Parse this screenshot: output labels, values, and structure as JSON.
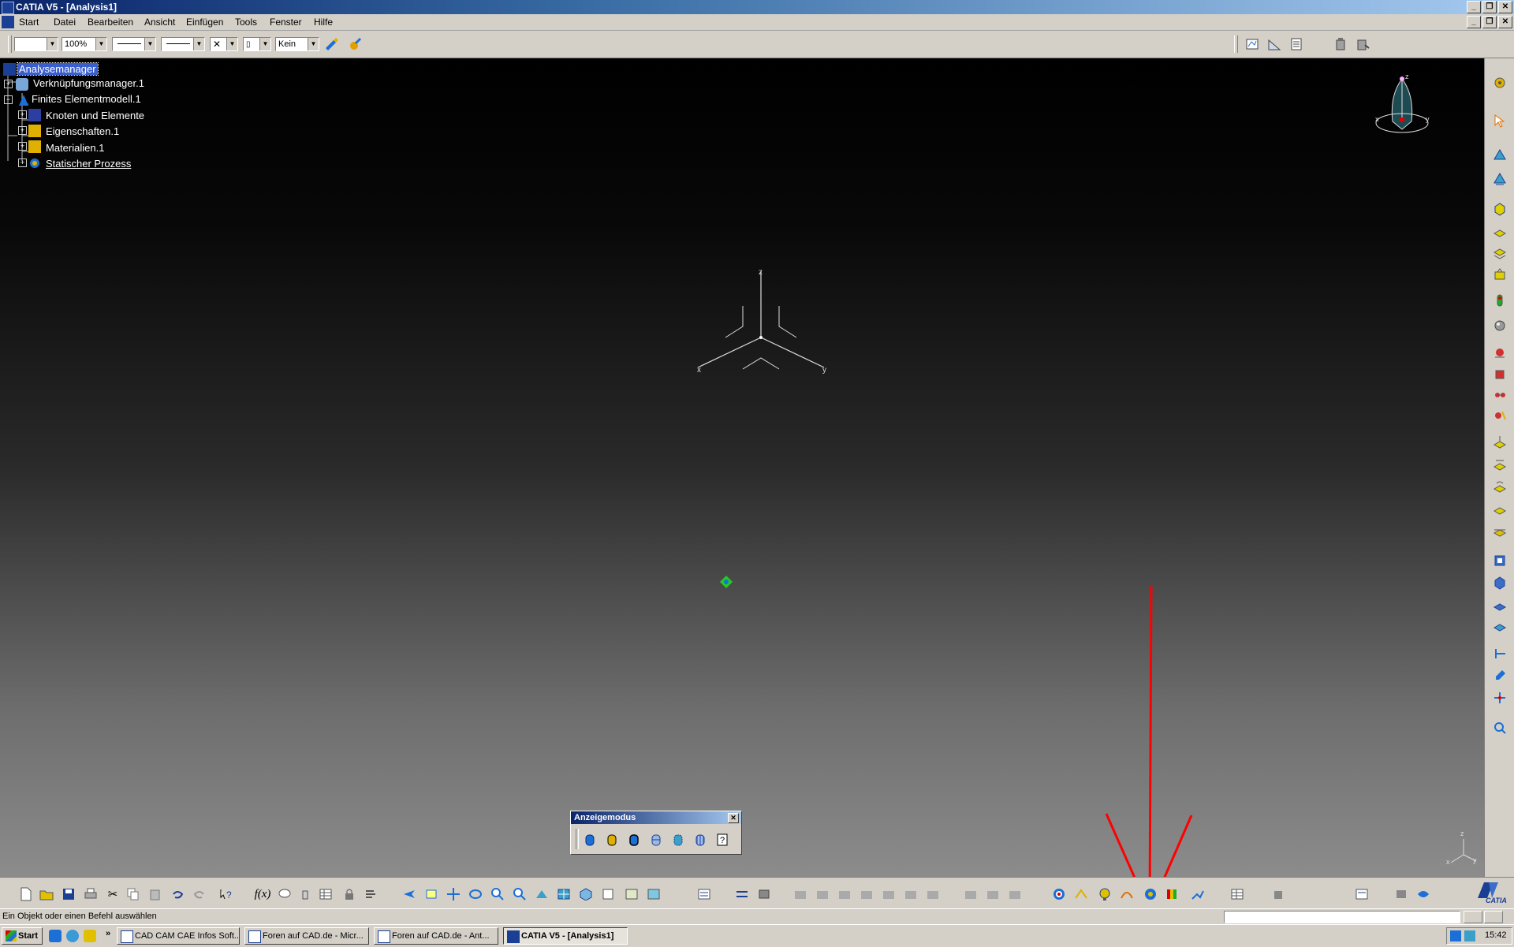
{
  "window": {
    "title": "CATIA V5 - [Analysis1]"
  },
  "menu": {
    "items": [
      "Start",
      "Datei",
      "Bearbeiten",
      "Ansicht",
      "Einfügen",
      "Tools",
      "Fenster",
      "Hilfe"
    ]
  },
  "toolbar_top": {
    "zoom_value": "100%",
    "layer_value": "Kein"
  },
  "tree": {
    "items": [
      {
        "label": "Analysemanager"
      },
      {
        "label": "Verknüpfungsmanager.1"
      },
      {
        "label": "Finites Elementmodell.1"
      },
      {
        "label": "Knoten und Elemente"
      },
      {
        "label": "Eigenschaften.1"
      },
      {
        "label": "Materialien.1"
      },
      {
        "label": "Statischer Prozess"
      }
    ]
  },
  "axes": {
    "x": "x",
    "y": "y",
    "z": "z"
  },
  "compass_axes": {
    "x": "x",
    "y": "y",
    "z": "z"
  },
  "mini_axes": {
    "x": "x",
    "y": "y",
    "z": "z"
  },
  "display_mode_toolbar": {
    "title": "Anzeigemodus"
  },
  "status": {
    "message": "Ein Objekt oder einen Befehl auswählen"
  },
  "branding": {
    "logo_text": "CATIA"
  },
  "taskbar": {
    "start_label": "Start",
    "buttons": [
      {
        "label": "CAD CAM CAE Infos Soft..."
      },
      {
        "label": "Foren auf CAD.de - Micr..."
      },
      {
        "label": "Foren auf CAD.de - Ant..."
      },
      {
        "label": "CATIA V5 - [Analysis1]"
      }
    ],
    "clock": "15:42"
  },
  "colors": {
    "annotation_arrow": "#ff0000",
    "selection": "#3a5fcd"
  }
}
